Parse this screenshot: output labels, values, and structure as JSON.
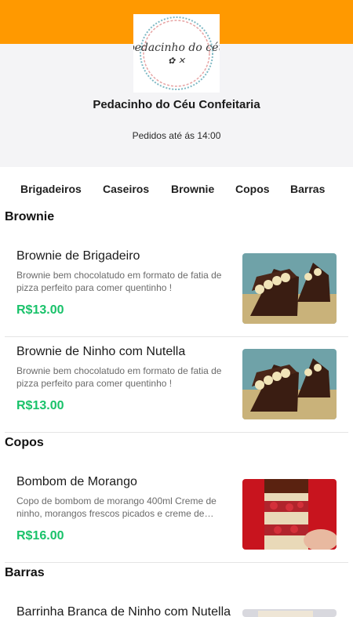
{
  "header": {
    "store_name": "Pedacinho do Céu Confeitaria",
    "hours": "Pedidos até ás 14:00",
    "logo_text": "pedacinho do céu",
    "colors": {
      "top_bar": "#ff9900",
      "header_bg": "#f4f4f6",
      "price": "#19c26a"
    }
  },
  "tabs": [
    "Brigadeiros",
    "Caseiros",
    "Brownie",
    "Copos",
    "Barras"
  ],
  "sections": [
    {
      "title": "Brownie",
      "items": [
        {
          "name": "Brownie de Brigadeiro",
          "description": "Brownie bem chocolatudo em formato de fatia de pizza perfeito para comer quentinho !",
          "price": "R$13.00",
          "image": "brownie-photo"
        },
        {
          "name": "Brownie de Ninho com Nutella",
          "description": "Brownie bem chocolatudo em formato de fatia de pizza perfeito para comer quentinho !",
          "price": "R$13.00",
          "image": "brownie-photo"
        }
      ]
    },
    {
      "title": "Copos",
      "items": [
        {
          "name": "Bombom de Morango",
          "description": "Copo de bombom de morango 400ml Creme de ninho, morangos frescos picados e creme de…",
          "price": "R$16.00",
          "image": "strawberry-cup-photo"
        }
      ]
    },
    {
      "title": "Barras",
      "items": [
        {
          "name": "Barrinha Branca de Ninho com Nutella",
          "image": "bar-photo"
        }
      ]
    }
  ]
}
